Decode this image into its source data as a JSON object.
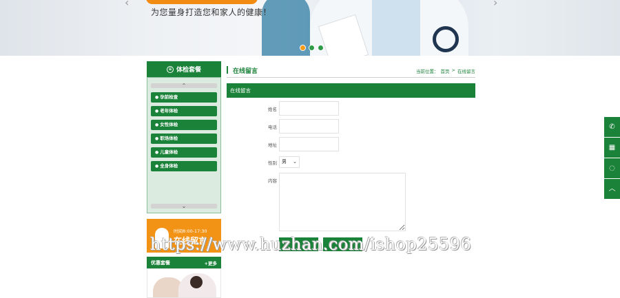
{
  "banner": {
    "slogan": "为您量身打造您和家人的健康！",
    "prev_arrow": "‹",
    "next_arrow": "›",
    "slide_dots": 3,
    "active_dot": 0
  },
  "sidebar": {
    "title": "体检套餐",
    "title_icon": "list-circle-icon",
    "scroll_up": "⌃",
    "scroll_down": "⌄",
    "items": [
      {
        "label": "孕前检查"
      },
      {
        "label": "老年体检"
      },
      {
        "label": "女性体检"
      },
      {
        "label": "职场体检"
      },
      {
        "label": "儿童体检"
      },
      {
        "label": "全身体检"
      }
    ]
  },
  "hours_banner": {
    "time_text": "时间8:00-17:30",
    "title": "在线留言"
  },
  "promo": {
    "title": "优惠套餐",
    "more": "+更多"
  },
  "main": {
    "section_title": "在线留言",
    "breadcrumb": {
      "prefix": "当前位置：",
      "home": "首页",
      "sep": ">",
      "current": "在线留言"
    },
    "form_title": "在线留言",
    "fields": {
      "name_label": "姓名",
      "phone_label": "电话",
      "address_label": "地址",
      "gender_label": "性别",
      "gender_value": "男",
      "content_label": "内容"
    },
    "submit_label": "",
    "reset_label": ""
  },
  "float_bar": {
    "icons": [
      "phone-icon",
      "qrcode-icon",
      "qq-icon",
      "back-to-top-icon"
    ],
    "glyphs": [
      "✆",
      "▦",
      "◌",
      "︿"
    ]
  },
  "watermark": "https://www.huzhan.com/ishop25596",
  "colors": {
    "brand_green": "#1b8239",
    "accent_orange": "#f39316",
    "panel_bg": "#dcebe0"
  }
}
